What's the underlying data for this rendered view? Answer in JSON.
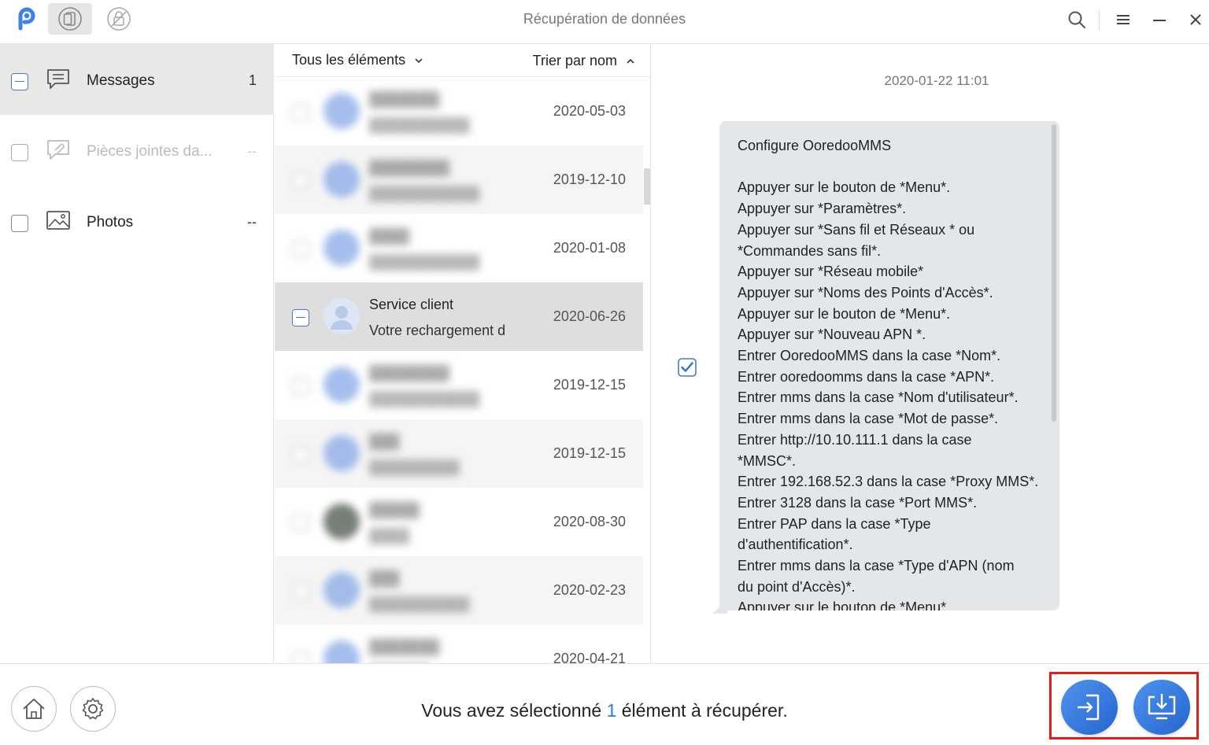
{
  "app": {
    "title": "Récupération de données",
    "accent_color": "#2a7ae2"
  },
  "toolbar": {
    "icons": [
      "logo-icon",
      "phone-recovery-icon",
      "unlock-icon"
    ],
    "window_controls": [
      "search-icon",
      "menu-icon",
      "minimize-icon",
      "close-icon"
    ]
  },
  "sidebar": {
    "categories": [
      {
        "label": "Messages",
        "count": "1",
        "state": "partial",
        "icon": "message-icon"
      },
      {
        "label": "Pièces jointes da...",
        "count": "--",
        "state": "disabled",
        "icon": "attachment-icon"
      },
      {
        "label": "Photos",
        "count": "--",
        "state": "unchecked",
        "icon": "photo-icon"
      }
    ]
  },
  "list": {
    "filter_label": "Tous les éléments",
    "sort_label": "Trier par nom",
    "rows": [
      {
        "name": "███████",
        "preview": "██████████",
        "date": "2020-05-03",
        "blurred": true
      },
      {
        "name": "████████",
        "preview": "███████████",
        "date": "2019-12-10",
        "blurred": true
      },
      {
        "name": "████",
        "preview": "███████████",
        "date": "2020-01-08",
        "blurred": true
      },
      {
        "name": "Service client",
        "preview": "Votre rechargement d",
        "date": "2020-06-26",
        "blurred": false
      },
      {
        "name": "████████",
        "preview": "███████████",
        "date": "2019-12-15",
        "blurred": true
      },
      {
        "name": "███",
        "preview": "█████████",
        "date": "2019-12-15",
        "blurred": true
      },
      {
        "name": "█████",
        "preview": "████",
        "date": "2020-08-30",
        "blurred": true
      },
      {
        "name": "███",
        "preview": "██████████",
        "date": "2020-02-23",
        "blurred": true
      },
      {
        "name": "███████",
        "preview": "██████",
        "date": "2020-04-21",
        "blurred": true
      }
    ]
  },
  "detail": {
    "timestamp": "2020-01-22 11:01",
    "message_text": "Configure OoredooMMS\n\nAppuyer sur le bouton de *Menu*.\nAppuyer sur *Paramètres*.\nAppuyer sur *Sans fil et Réseaux * ou\n*Commandes sans fil*.\nAppuyer sur *Réseau mobile*\nAppuyer sur *Noms des Points d'Accès*.\nAppuyer sur le bouton de *Menu*.\nAppuyer sur *Nouveau APN *.\nEntrer OoredooMMS dans la case *Nom*.\nEntrer ooredoomms dans la case *APN*.\nEntrer mms dans la case *Nom d'utilisateur*.\nEntrer mms dans la case *Mot de passe*.\nEntrer http://10.10.111.1 dans la case\n*MMSC*.\nEntrer 192.168.52.3 dans la case *Proxy MMS*.\nEntrer 3128 dans la case *Port MMS*.\nEntrer PAP dans la case *Type\nd'authentification*.\nEntrer mms dans la case *Type d'APN (nom\ndu point d'Accès)*.\nAppuyer sur le bouton de *Menu*",
    "checked": true
  },
  "footer": {
    "status_prefix": "Vous avez sélectionné ",
    "status_count": "1",
    "status_suffix": " élément à récupérer.",
    "left_buttons": [
      "home-icon",
      "settings-icon"
    ],
    "action_buttons": [
      "restore-to-device-icon",
      "download-to-computer-icon"
    ]
  }
}
